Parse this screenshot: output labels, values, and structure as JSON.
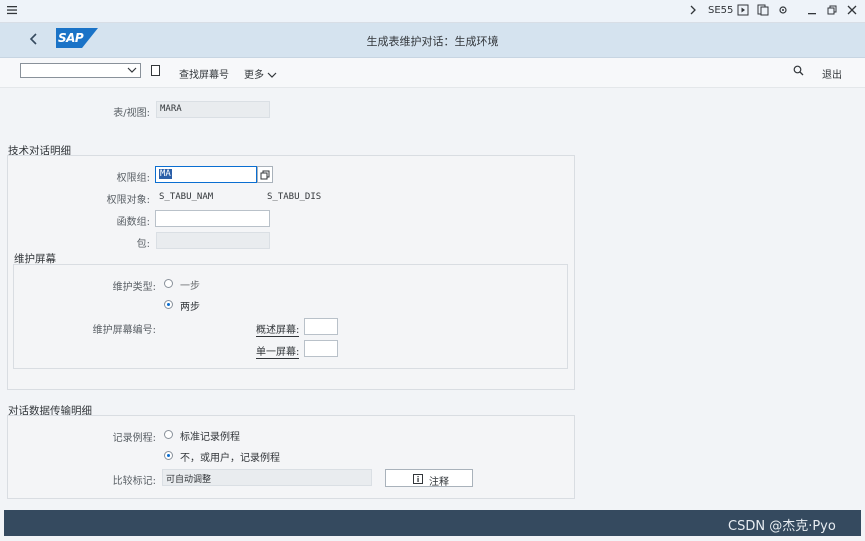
{
  "sysbar": {
    "tcode": "SE55"
  },
  "header": {
    "title": "生成表维护对话：生成环境",
    "logo_text": "SAP"
  },
  "toolbar": {
    "dropdown_value": "",
    "find_screen": "查找屏幕号",
    "more": "更多",
    "exit": "退出"
  },
  "table_view": {
    "label": "表/视图:",
    "value": "MARA"
  },
  "tech_details": {
    "title": "技术对话明细",
    "auth_group_label": "权限组:",
    "auth_group_value": "MA",
    "auth_object_label": "权限对象:",
    "auth_object_1": "S_TABU_NAM",
    "auth_object_2": "S_TABU_DIS",
    "func_group_label": "函数组:",
    "func_group_value": "",
    "package_label": "包:",
    "package_value": ""
  },
  "maint_screen": {
    "title": "维护屏幕",
    "type_label": "维护类型:",
    "one_step": "一步",
    "two_step": "两步",
    "selected": "two_step",
    "screen_no_label": "维护屏幕编号:",
    "overview_label": "概述屏幕:",
    "overview_value": "",
    "single_label": "单一屏幕:",
    "single_value": ""
  },
  "transport": {
    "title": "对话数据传输明细",
    "routine_label": "记录例程:",
    "std_routine": "标准记录例程",
    "no_routine": "不，或用户，记录例程",
    "selected": "no_routine",
    "compare_label": "比较标记:",
    "compare_value": "可自动调整",
    "note_button": "注释"
  },
  "watermark": "CSDN @杰克·Pyo"
}
